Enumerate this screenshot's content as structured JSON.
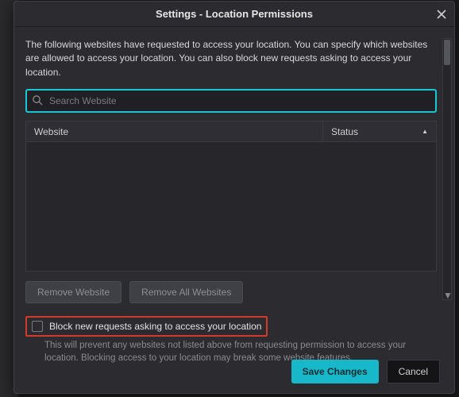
{
  "title": "Settings - Location Permissions",
  "description": "The following websites have requested to access your location. You can specify which websites are allowed to access your location. You can also block new requests asking to access your location.",
  "search": {
    "placeholder": "Search Website",
    "value": ""
  },
  "table": {
    "headers": {
      "website": "Website",
      "status": "Status"
    },
    "rows": []
  },
  "buttons": {
    "remove": "Remove Website",
    "removeAll": "Remove All Websites",
    "save": "Save Changes",
    "cancel": "Cancel"
  },
  "checkbox": {
    "label": "Block new requests asking to access your location",
    "checked": false
  },
  "hint": "This will prevent any websites not listed above from requesting permission to access your location. Blocking access to your location may break some website features."
}
